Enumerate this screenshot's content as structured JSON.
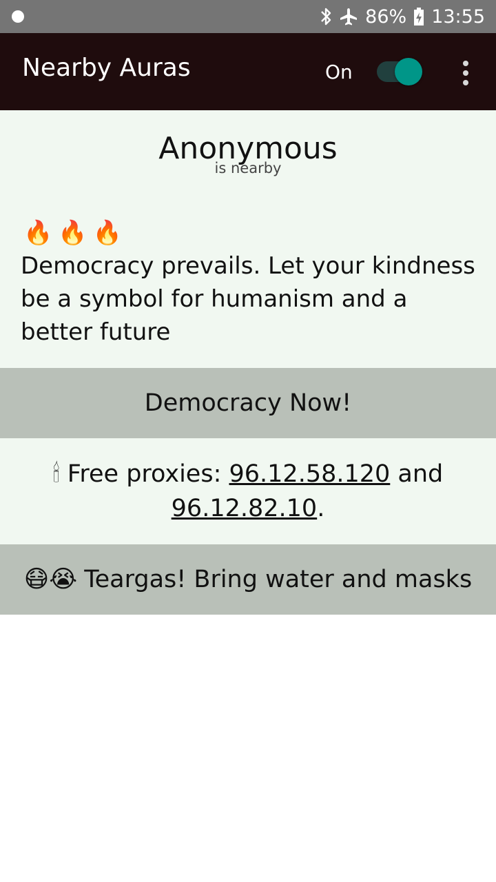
{
  "status_bar": {
    "battery": "86%",
    "time": "13:55",
    "icons": [
      "notification-dot-icon",
      "bluetooth-icon",
      "airplane-icon",
      "battery-charging-icon"
    ]
  },
  "app_bar": {
    "title": "Nearby Auras",
    "switch_label": "On",
    "switch_state": "on",
    "overflow_icon": "more-vert-icon"
  },
  "aura": {
    "author": "Anonymous",
    "subtitle": "is nearby",
    "emoji": "🔥🔥🔥",
    "message": "Democracy prevails. Let your kindness be a symbol for humanism and a better future"
  },
  "rows": [
    {
      "text": "Democracy Now!"
    },
    {
      "emoji": "🕯",
      "prefix": "Free proxies: ",
      "link1": "96.12.58.120",
      "middle": " and ",
      "link2": "96.12.82.10",
      "suffix": "."
    },
    {
      "emoji": "😷😭",
      "text": "Teargas! Bring water and masks"
    }
  ],
  "colors": {
    "status_bar": "#757575",
    "app_bar": "#1f0c0d",
    "accent": "#009688",
    "card_light": "#f1f8f1",
    "card_grey": "#b9c0b8"
  }
}
